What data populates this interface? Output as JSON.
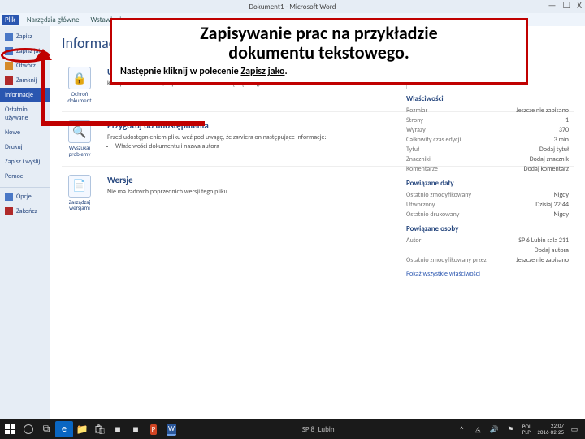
{
  "window": {
    "title": "Dokument1 - Microsoft Word",
    "controls": {
      "min": "—",
      "max": "☐",
      "close": "X"
    }
  },
  "ribbon": {
    "tabs": [
      "Plik",
      "Narzędzia główne",
      "Wstawianie"
    ]
  },
  "backstage_nav": [
    {
      "label": "Zapisz"
    },
    {
      "label": "Zapisz jako"
    },
    {
      "label": "Otwórz"
    },
    {
      "label": "Zamknij"
    },
    {
      "label": "Informacje",
      "selected": true
    },
    {
      "label": "Ostatnio używane"
    },
    {
      "label": "Nowe"
    },
    {
      "label": "Drukuj"
    },
    {
      "label": "Zapisz i wyślij"
    },
    {
      "label": "Pomoc"
    },
    {
      "label": "Opcje"
    },
    {
      "label": "Zakończ"
    }
  ],
  "page": {
    "heading": "Informacje",
    "sections": [
      {
        "icon_caption": "Ochroń dokument",
        "title": "Uprawnienia",
        "desc": "Każdy może otwierać, kopiować i zmieniać każdą część tego dokumentu."
      },
      {
        "icon_caption": "Wyszukaj problemy",
        "title": "Przygotuj do udostępnienia",
        "desc": "Przed udostępnieniem pliku weź pod uwagę, że zawiera on następujące informacje:",
        "bullet": "Właściwości dokumentu i nazwa autora"
      },
      {
        "icon_caption": "Zarządzaj wersjami",
        "title": "Wersje",
        "desc": "Nie ma żadnych poprzednich wersji tego pliku."
      }
    ]
  },
  "properties": {
    "heading1": "Właściwości",
    "rows1": [
      {
        "k": "Rozmiar",
        "v": "Jeszcze nie zapisano"
      },
      {
        "k": "Strony",
        "v": "1"
      },
      {
        "k": "Wyrazy",
        "v": "370"
      },
      {
        "k": "Całkowity czas edycji",
        "v": "3 min"
      },
      {
        "k": "Tytuł",
        "v": "Dodaj tytuł"
      },
      {
        "k": "Znaczniki",
        "v": "Dodaj znacznik"
      },
      {
        "k": "Komentarze",
        "v": "Dodaj komentarz"
      }
    ],
    "heading2": "Powiązane daty",
    "rows2": [
      {
        "k": "Ostatnio zmodyfikowany",
        "v": "Nigdy"
      },
      {
        "k": "Utworzony",
        "v": "Dzisiaj 22:44"
      },
      {
        "k": "Ostatnio drukowany",
        "v": "Nigdy"
      }
    ],
    "heading3": "Powiązane osoby",
    "rows3": [
      {
        "k": "Autor",
        "v": "SP 6 Lubin sala 211"
      },
      {
        "k": "",
        "v": "Dodaj autora"
      },
      {
        "k": "Ostatnio zmodyfikowany przez",
        "v": "Jeszcze nie zapisano"
      }
    ],
    "show_all": "Pokaż wszystkie właściwości"
  },
  "callout": {
    "title1": "Zapisywanie prac na przykładzie",
    "title2": "dokumentu tekstowego.",
    "instr_prefix": "Następnie kliknij w polecenie ",
    "instr_underlined": "Zapisz jako"
  },
  "taskbar": {
    "center": "SP 8_Lubin",
    "lang": "POL\nPLP",
    "time": "22:07",
    "date": "2016-02-25"
  }
}
